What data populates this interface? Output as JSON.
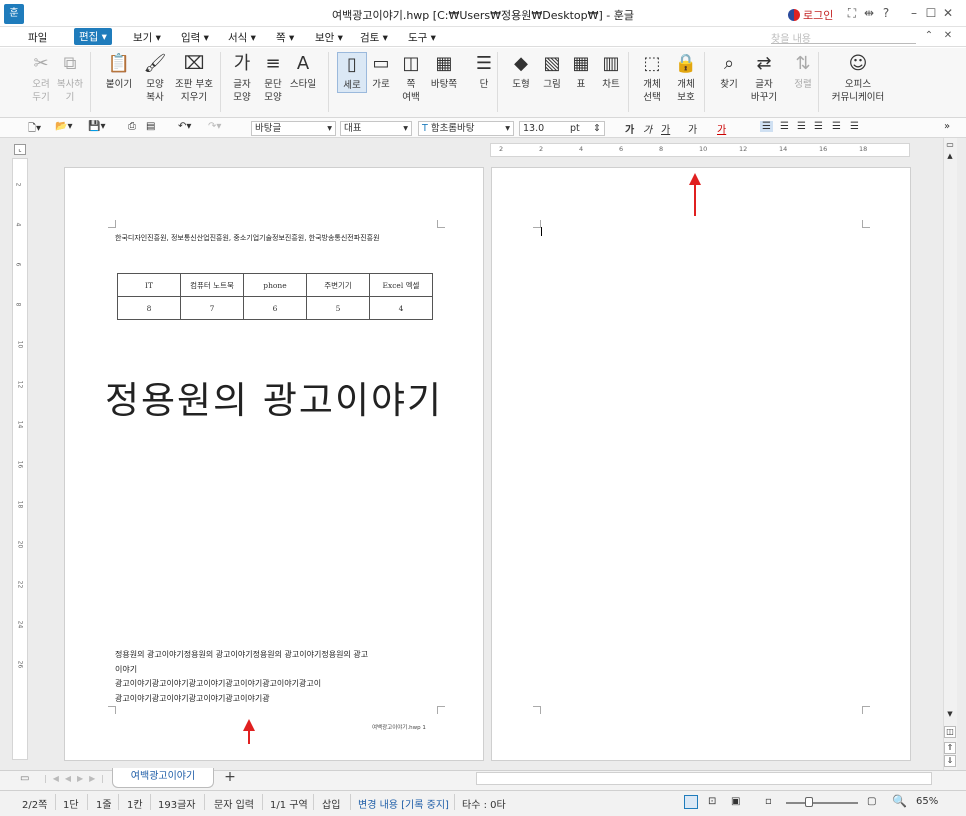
{
  "window": {
    "title": "여백광고이야기.hwp [C:₩Users₩정용원₩Desktop₩] - 훈글",
    "app_logo": "훈",
    "login": "로그인"
  },
  "menu": {
    "items": [
      "파일",
      "편집",
      "보기",
      "입력",
      "서식",
      "쪽",
      "보안",
      "검토",
      "도구"
    ],
    "search_placeholder": "찾을 내용"
  },
  "ribbon": {
    "buttons": [
      {
        "label": "오려\n두기",
        "icon": "scissors-icon"
      },
      {
        "label": "복사하기",
        "icon": "copy-icon"
      },
      {
        "label": "붙이기",
        "icon": "paste-icon"
      },
      {
        "label": "모양\n복사",
        "icon": "format-painter-icon"
      },
      {
        "label": "조판 부호\n지우기",
        "icon": "clear-code-icon"
      },
      {
        "label": "글자\n모양",
        "icon": "char-shape-icon"
      },
      {
        "label": "문단\n모양",
        "icon": "para-shape-icon"
      },
      {
        "label": "스타일",
        "icon": "style-icon"
      },
      {
        "label": "세로",
        "icon": "portrait-icon"
      },
      {
        "label": "가로",
        "icon": "landscape-icon"
      },
      {
        "label": "쪽\n여백",
        "icon": "margin-icon"
      },
      {
        "label": "바탕쪽",
        "icon": "master-page-icon"
      },
      {
        "label": "단",
        "icon": "columns-icon"
      },
      {
        "label": "도형",
        "icon": "shape-icon"
      },
      {
        "label": "그림",
        "icon": "picture-icon"
      },
      {
        "label": "표",
        "icon": "table-icon"
      },
      {
        "label": "차트",
        "icon": "chart-icon"
      },
      {
        "label": "개체\n선택",
        "icon": "select-object-icon"
      },
      {
        "label": "개체\n보호",
        "icon": "protect-object-icon"
      },
      {
        "label": "찾기",
        "icon": "find-icon"
      },
      {
        "label": "글자\n바꾸기",
        "icon": "replace-icon"
      },
      {
        "label": "정렬",
        "icon": "sort-icon"
      },
      {
        "label": "오피스\n커뮤니케이터",
        "icon": "communicator-icon"
      }
    ]
  },
  "format_bar": {
    "style": "바탕글",
    "lang": "대표",
    "font": "함초롬바탕",
    "size": "13.0",
    "unit": "pt",
    "styles": [
      "가",
      "가",
      "가",
      "가",
      "가"
    ]
  },
  "document": {
    "orgs": "한국디자인진흥원, 정보통신산업진흥원, 중소기업기술정보진흥원, 한국방송통신전파진흥원",
    "table": {
      "headers": [
        "IT",
        "컴퓨터 노트북",
        "phone",
        "주변기기",
        "Excel 엑셀"
      ],
      "values": [
        "8",
        "7",
        "6",
        "5",
        "4"
      ]
    },
    "title": "정용원의 광고이야기",
    "body_lines": [
      "정용원의 광고이야기정용원의 광고이야기정용원의 광고이야기정용원의 광고",
      "이야기",
      "광고이야기광고이야기광고이야기광고이야기광고이야기광고이",
      "광고이야기광고이야기광고이야기광고이야기광"
    ],
    "footer": "여백광고이야기.hwp 1"
  },
  "ruler_numbers": [
    "2",
    "2",
    "4",
    "6",
    "8",
    "10",
    "12",
    "14",
    "16",
    "18"
  ],
  "vruler_numbers": [
    "2",
    "4",
    "6",
    "8",
    "10",
    "12",
    "14",
    "16",
    "18",
    "20",
    "22",
    "24",
    "26"
  ],
  "tabs": {
    "doc_tab": "여백광고이야기",
    "add": "+"
  },
  "status": {
    "page": "2/2쪽",
    "col": "1단",
    "line": "1줄",
    "char": "1칸",
    "count": "193글자",
    "mode": "문자 입력",
    "section": "1/1 구역",
    "insert": "삽입",
    "track": "변경 내용 [기록 중지]",
    "typo": "타수 : 0타",
    "zoom": "65%"
  },
  "colors": {
    "accent": "#1f7cbc",
    "arrow": "#e02020"
  }
}
